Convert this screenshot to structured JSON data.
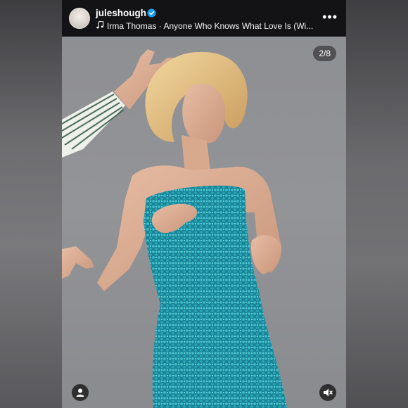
{
  "post": {
    "username": "juleshough",
    "music": {
      "artist_song": "Irma Thomas · Anyone Who Knows What Love Is (Wi..."
    },
    "more_label": "•••",
    "image_counter": "2/8"
  },
  "icons": {
    "verified": "verified-badge-icon",
    "music": "music-note-icon",
    "tag": "user-tag-icon",
    "mute": "speaker-muted-icon"
  },
  "colors": {
    "header_bg": "#131315",
    "verified_blue": "#1d9bf0",
    "dress_teal": "#1f8fa0"
  }
}
